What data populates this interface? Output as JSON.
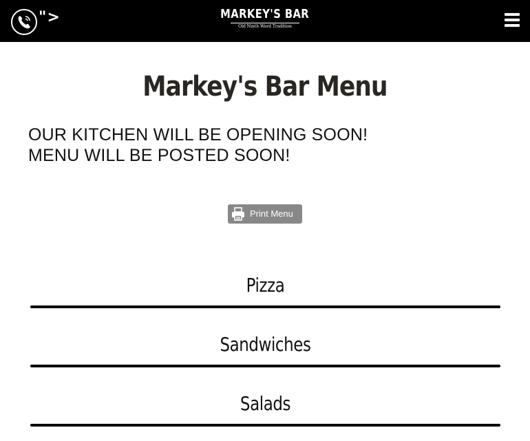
{
  "header": {
    "phone_icon": "phone-icon",
    "stray_text": "\">",
    "logo": {
      "name": "MARKEY'S BAR",
      "tagline": "Old Ninth Ward Tradition"
    },
    "menu_icon": "hamburger-menu-icon"
  },
  "main": {
    "title": "Markey's Bar Menu",
    "notice_lines": [
      "OUR KITCHEN WILL BE OPENING SOON!",
      "MENU WILL BE POSTED SOON!"
    ],
    "print_button": {
      "label": "Print Menu",
      "icon": "printer-icon"
    }
  },
  "sections": [
    {
      "title": "Pizza"
    },
    {
      "title": "Sandwiches"
    },
    {
      "title": "Salads"
    }
  ],
  "colors": {
    "header_bg": "#000000",
    "title_color": "#2a2723",
    "print_button_bg": "#888888"
  }
}
